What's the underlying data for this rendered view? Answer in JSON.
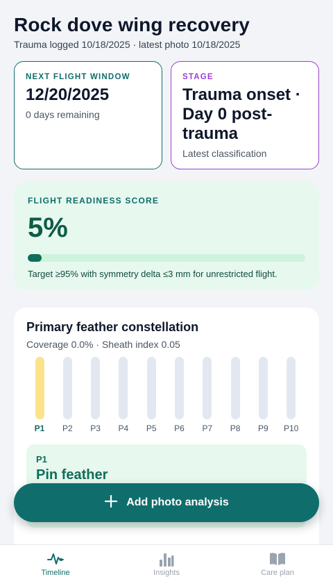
{
  "header": {
    "title": "Rock dove wing recovery",
    "subtitle": "Trauma logged 10/18/2025 · latest photo 10/18/2025"
  },
  "flight_card": {
    "label": "NEXT FLIGHT WINDOW",
    "date": "12/20/2025",
    "remaining": "0 days remaining"
  },
  "stage_card": {
    "label": "STAGE",
    "value": "Trauma onset · Day 0 post-trauma",
    "note": "Latest classification"
  },
  "readiness": {
    "label": "FLIGHT READINESS SCORE",
    "value": "5%",
    "progress_fraction": 0.05,
    "note": "Target ≥95% with symmetry delta ≤3 mm for unrestricted flight."
  },
  "constellation": {
    "title": "Primary feather constellation",
    "subtitle": "Coverage 0.0% · Sheath index 0.05",
    "feathers": [
      {
        "label": "P1",
        "active": true
      },
      {
        "label": "P2",
        "active": false
      },
      {
        "label": "P3",
        "active": false
      },
      {
        "label": "P4",
        "active": false
      },
      {
        "label": "P5",
        "active": false
      },
      {
        "label": "P6",
        "active": false
      },
      {
        "label": "P7",
        "active": false
      },
      {
        "label": "P8",
        "active": false
      },
      {
        "label": "P9",
        "active": false
      },
      {
        "label": "P10",
        "active": false
      }
    ],
    "detail": {
      "code": "P1",
      "name": "Pin feather"
    }
  },
  "fab": {
    "label": "Add photo analysis",
    "icon": "plus-icon"
  },
  "tabbar": {
    "tabs": [
      {
        "label": "Timeline",
        "icon": "pulse-icon",
        "active": true
      },
      {
        "label": "Insights",
        "icon": "bar-chart-icon",
        "active": false
      },
      {
        "label": "Care plan",
        "icon": "book-icon",
        "active": false
      }
    ]
  },
  "colors": {
    "accent": "#0f6e6b",
    "stage": "#9b3fcf",
    "active_feather": "#fbe38a",
    "readiness_bg": "#e7f8ee"
  }
}
